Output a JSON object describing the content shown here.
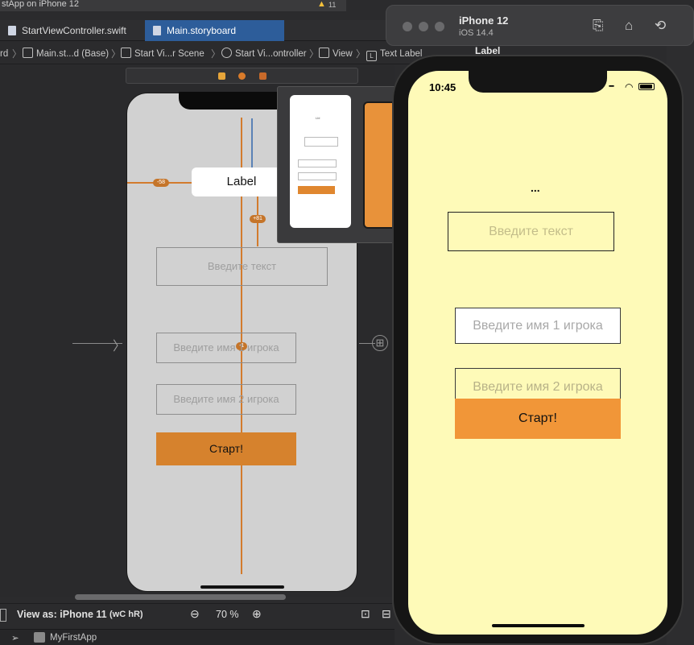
{
  "xcode": {
    "run_target": "stApp on iPhone 12",
    "warning_count": "11",
    "tabs": [
      {
        "label": "StartViewController.swift",
        "active": false
      },
      {
        "label": "Main.storyboard",
        "active": true
      }
    ],
    "breadcrumbs": [
      "rd",
      "Main.st...d (Base)",
      "Start Vi...r Scene",
      "Start Vi...ontroller",
      "View",
      "Text Label"
    ],
    "inspector_title": "Label",
    "bottom": {
      "view_as": "View as: iPhone 11",
      "size_class": "(wC hR)",
      "zoom": "70 %"
    },
    "status_project": "MyFirstApp"
  },
  "storyboard": {
    "label": "Label",
    "text_field_placeholder": "Введите текст",
    "player1_placeholder": "Введите имя 1 игрока",
    "player2_placeholder": "Введите имя 2 игрока",
    "start_button": "Старт!",
    "constraint_left": "-58",
    "constraint_top": "+81",
    "constraint_mid": "-1"
  },
  "simulator": {
    "device_name": "iPhone 12",
    "os_version": "iOS 14.4",
    "time": "10:45",
    "label_text": "...",
    "text_field_placeholder": "Введите текст",
    "player1_placeholder": "Введите имя 1 игрока",
    "player2_placeholder": "Введите имя 2 игрока",
    "start_button": "Старт!",
    "screen_color": "#fefab8",
    "button_color": "#f19638"
  }
}
